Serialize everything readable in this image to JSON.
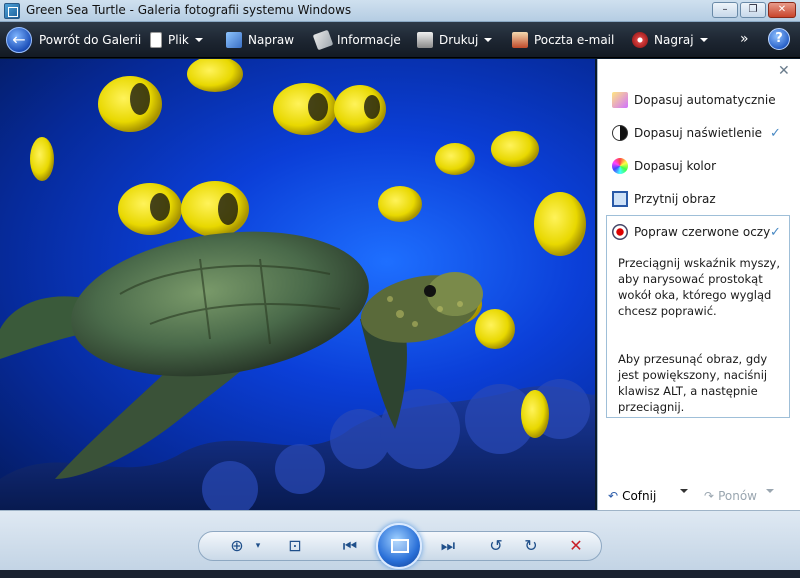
{
  "window": {
    "title": "Green Sea Turtle - Galeria fotografii systemu Windows",
    "minimize_glyph": "–",
    "maximize_glyph": "❐",
    "close_glyph": "✕"
  },
  "toolbar": {
    "back_label": "Powrót do Galerii",
    "file_label": "Plik",
    "fix_label": "Napraw",
    "info_label": "Informacje",
    "print_label": "Drukuj",
    "email_label": "Poczta e-mail",
    "burn_label": "Nagraj",
    "more_glyph": "»",
    "help_glyph": "?"
  },
  "panel": {
    "close_glyph": "✕",
    "items": [
      {
        "label": "Dopasuj automatycznie",
        "icon": "magic-wand-icon"
      },
      {
        "label": "Dopasuj naświetlenie",
        "icon": "exposure-icon",
        "checked": true
      },
      {
        "label": "Dopasuj kolor",
        "icon": "color-wheel-icon"
      },
      {
        "label": "Przytnij obraz",
        "icon": "crop-icon"
      },
      {
        "label": "Popraw czerwone oczy",
        "icon": "red-eye-icon",
        "checked": true
      }
    ],
    "check_glyph": "✓",
    "help_text_1": "Przeciągnij wskaźnik myszy, aby narysować prostokąt wokół oka, którego wygląd chcesz poprawić.",
    "help_text_2": "Aby przesunąć obraz, gdy jest powiększony, naciśnij klawisz ALT, a następnie przeciągnij.",
    "undo_label": "Cofnij",
    "redo_label": "Ponów"
  },
  "controls": {
    "zoom_glyph": "⊕",
    "fit_glyph": "⊡",
    "prev_glyph": "⏮",
    "next_glyph": "⏭",
    "rotate_ccw_glyph": "↺",
    "rotate_cw_glyph": "↻",
    "delete_glyph": "✕"
  },
  "colors": {
    "toolbar_bg": "#1e2733",
    "accent": "#2a70d8",
    "delete": "#c8202a"
  }
}
